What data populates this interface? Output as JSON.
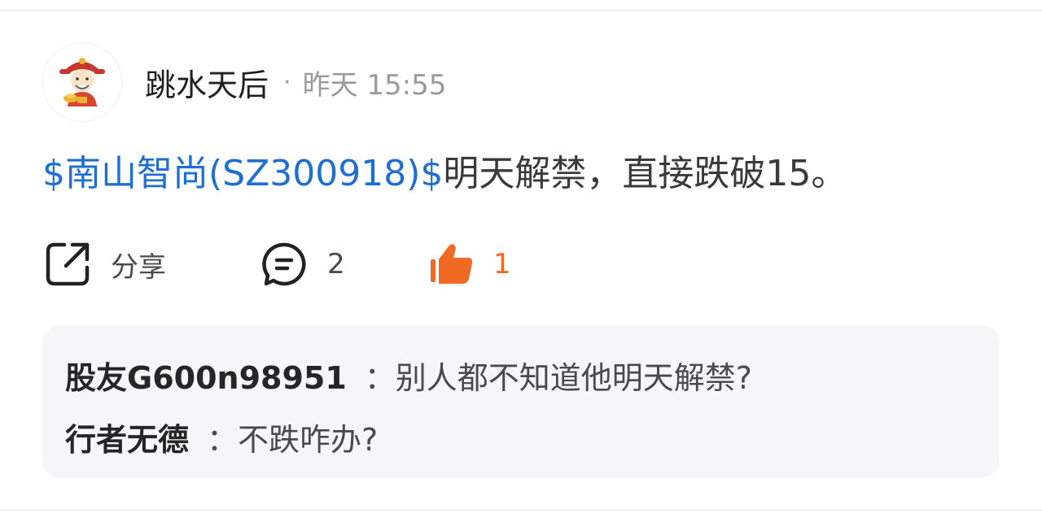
{
  "post": {
    "author": "跳水天后",
    "separator": "·",
    "timestamp": "昨天 15:55",
    "stock_tag": "$南山智尚(SZ300918)$",
    "content": "明天解禁，直接跌破15。"
  },
  "actions": {
    "share_label": "分享",
    "comment_count": "2",
    "like_count": "1"
  },
  "comments": [
    {
      "author": "股友G600n98951",
      "separator": "：",
      "text": "别人都不知道他明天解禁?"
    },
    {
      "author": "行者无德",
      "separator": "：",
      "text": "不跌咋办?"
    }
  ],
  "colors": {
    "link": "#1e6fd0",
    "like_active": "#f06a25",
    "muted": "#9a9a9a",
    "comment_bg": "#f5f6f8"
  },
  "icons": {
    "avatar": "caishen-avatar-icon",
    "share": "share-icon",
    "comment": "comment-icon",
    "like": "thumbs-up-icon"
  }
}
